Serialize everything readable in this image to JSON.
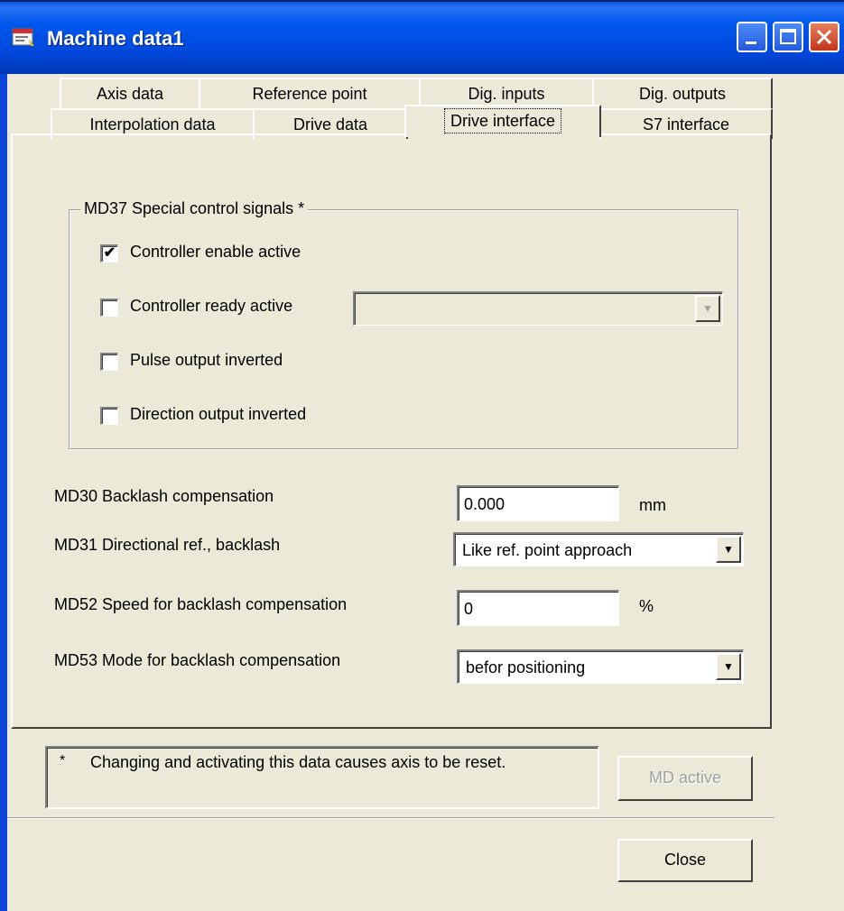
{
  "window": {
    "title": "Machine data1"
  },
  "tabs_row1": [
    "Axis data",
    "Reference point",
    "Dig. inputs",
    "Dig. outputs"
  ],
  "tabs_row2": [
    "Interpolation data",
    "Drive data",
    "Drive interface",
    "S7 interface"
  ],
  "active_tab": "Drive interface",
  "group": {
    "title": "MD37 Special control signals *",
    "checkboxes": [
      {
        "label": "Controller enable active",
        "checked": true
      },
      {
        "label": "Controller ready active",
        "checked": false
      },
      {
        "label": "Pulse output inverted",
        "checked": false
      },
      {
        "label": "Direction output inverted",
        "checked": false
      }
    ],
    "ready_combo_value": ""
  },
  "fields": {
    "md30": {
      "label": "MD30 Backlash compensation",
      "value": "0.000",
      "unit": "mm"
    },
    "md31": {
      "label": "MD31 Directional ref., backlash",
      "value": "Like ref. point approach"
    },
    "md52": {
      "label": "MD52 Speed for backlash compensation",
      "value": "0",
      "unit": "%"
    },
    "md53": {
      "label": "MD53 Mode for backlash compensation",
      "value": "befor positioning"
    }
  },
  "note": {
    "star": "*",
    "text": "Changing and activating this data causes axis to be reset."
  },
  "buttons": {
    "md_active": "MD active",
    "close": "Close"
  },
  "colors": {
    "titlebar": "#0058ee",
    "face": "#ece9d8"
  }
}
